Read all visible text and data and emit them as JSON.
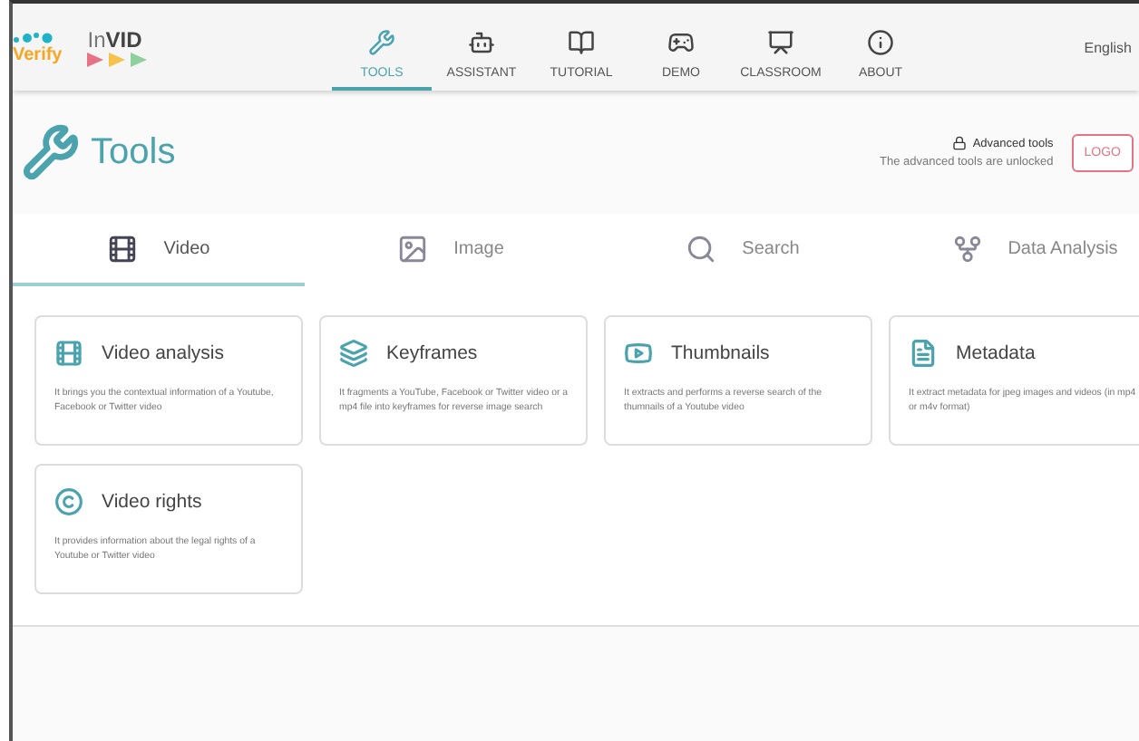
{
  "logo": {
    "verify": "Verify",
    "invid_light": "In",
    "invid_bold": "VID"
  },
  "nav": [
    {
      "kind": "wrench",
      "label": "TOOLS",
      "selected": true
    },
    {
      "kind": "robot",
      "label": "ASSISTANT",
      "selected": false
    },
    {
      "kind": "book",
      "label": "TUTORIAL",
      "selected": false
    },
    {
      "kind": "gamepad",
      "label": "DEMO",
      "selected": false
    },
    {
      "kind": "classroom",
      "label": "CLASSROOM",
      "selected": false
    },
    {
      "kind": "info",
      "label": "ABOUT",
      "selected": false
    }
  ],
  "language": "English",
  "page_title": "Tools",
  "advanced": {
    "label": "Advanced tools",
    "status": "The advanced tools are unlocked",
    "button": "LOGO"
  },
  "tabs": [
    {
      "kind": "film",
      "label": "Video",
      "selected": true
    },
    {
      "kind": "image",
      "label": "Image",
      "selected": false
    },
    {
      "kind": "search",
      "label": "Search",
      "selected": false
    },
    {
      "kind": "fork",
      "label": "Data Analysis",
      "selected": false
    }
  ],
  "cards": [
    {
      "kind": "film",
      "title": "Video analysis",
      "description": "It brings you the contextual information of a Youtube, Facebook or Twitter video"
    },
    {
      "kind": "frames",
      "title": "Keyframes",
      "description": "It fragments a YouTube, Facebook or Twitter video or a mp4 file into keyframes for reverse image search"
    },
    {
      "kind": "play",
      "title": "Thumbnails",
      "description": "It extracts and performs a reverse search of the thumnails of a Youtube video"
    },
    {
      "kind": "file",
      "title": "Metadata",
      "description": "It extract metadata for jpeg images and videos (in mp4 or m4v format)"
    },
    {
      "kind": "copyright",
      "title": "Video rights",
      "description": "It provides information about the legal rights of a Youtube or Twitter video"
    }
  ]
}
